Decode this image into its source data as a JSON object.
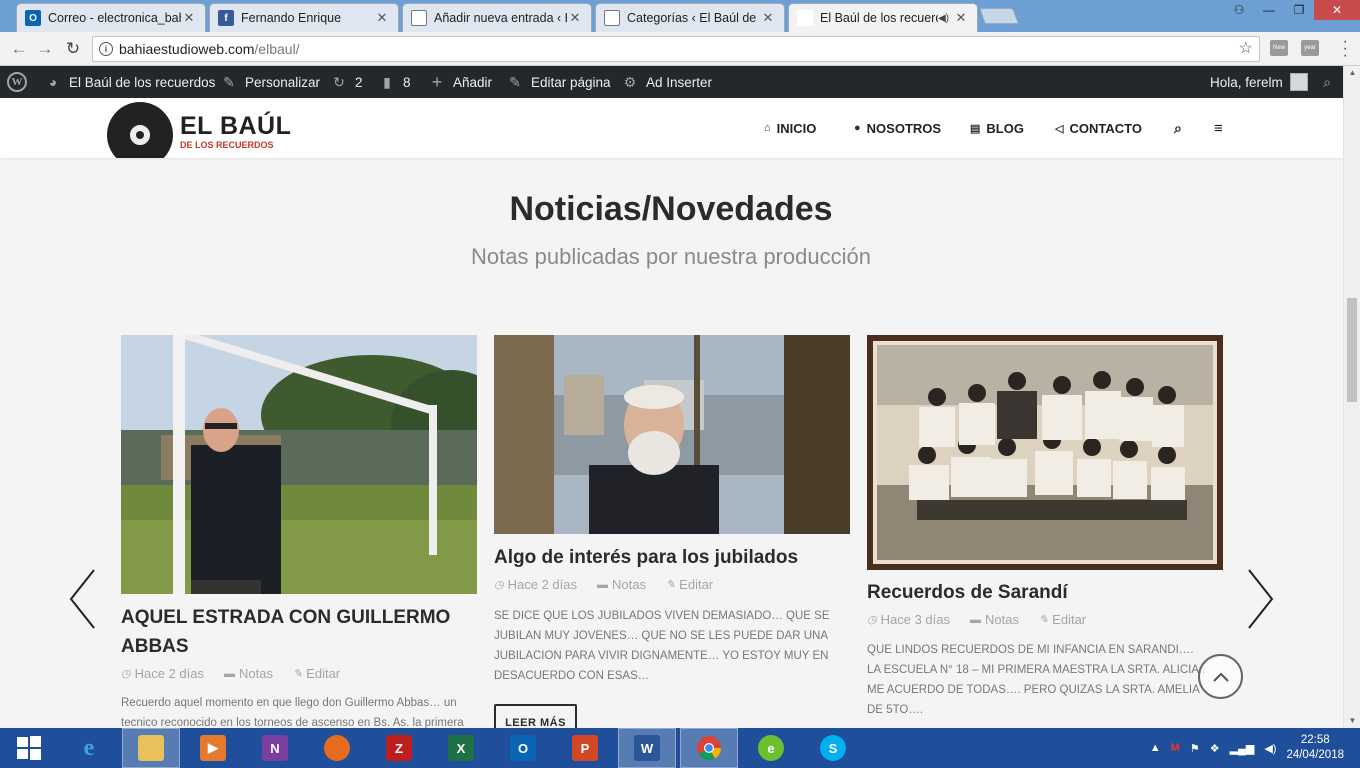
{
  "browser": {
    "tabs": [
      {
        "title": "Correo - electronica_bahi",
        "favicon": "outlook-icon",
        "active": false
      },
      {
        "title": "Fernando Enrique",
        "favicon": "facebook-icon",
        "active": false
      },
      {
        "title": "Añadir nueva entrada ‹ El",
        "favicon": "page-icon",
        "active": false
      },
      {
        "title": "Categorías ‹ El Baúl de lo",
        "favicon": "page-icon",
        "active": false
      },
      {
        "title": "El Baúl de los recuerdo",
        "favicon": "blank-page-icon",
        "active": true
      }
    ],
    "url_host": "bahiaestudioweb.com",
    "url_path": "/elbaul/",
    "extensions": [
      "New",
      "year"
    ]
  },
  "wp_admin_bar": {
    "site_name": "El Baúl de los recuerdos",
    "customize": "Personalizar",
    "updates": "2",
    "comments": "8",
    "add_new": "Añadir",
    "edit_page": "Editar página",
    "ad_inserter": "Ad Inserter",
    "greeting": "Hola, ferelm"
  },
  "site": {
    "logo_title": "EL BAÚL",
    "logo_subtitle": "DE LOS RECUERDOS",
    "nav": [
      "INICIO",
      "NOSOTROS",
      "BLOG",
      "CONTACTO"
    ],
    "accent_color": "#c0392b"
  },
  "section": {
    "title": "Noticias/Novedades",
    "subtitle": "Notas publicadas por nuestra producción"
  },
  "posts": [
    {
      "title": "AQUEL ESTRADA CON GUILLERMO ABBAS",
      "date": "Hace 2 días",
      "category": "Notas",
      "edit": "Editar",
      "excerpt": "Recuerdo aquel momento en que llego don Guillermo Abbas… un tecnico reconocido en los torneos de ascenso en Bs. As. la primera"
    },
    {
      "title": "Algo de interés para los jubilados",
      "date": "Hace 2 días",
      "category": "Notas",
      "edit": "Editar",
      "excerpt": "SE DICE QUE LOS JUBILADOS VIVEN DEMASIADO… QUE SE JUBILAN MUY JOVENES… QUE NO SE LES PUEDE DAR UNA JUBILACION PARA VIVIR DIGNAMENTE… YO ESTOY MUY EN DESACUERDO CON ESAS…",
      "read_more": "LEER MÁS"
    },
    {
      "title": "Recuerdos de Sarandí",
      "date": "Hace 3 días",
      "category": "Notas",
      "edit": "Editar",
      "excerpt": "QUE LINDOS RECUERDOS DE MI INFANCIA EN SARANDI…. LA ESCUELA N° 18 – MI PRIMERA MAESTRA LA SRTA. ALICIA.. ME ACUERDO DE TODAS…. PERO QUIZAS LA SRTA. AMELIA DE 5TO…."
    }
  ],
  "taskbar": {
    "apps": [
      "internet-explorer",
      "file-explorer",
      "media-player",
      "onenote",
      "firefox",
      "filezilla",
      "excel",
      "outlook",
      "powerpoint",
      "word",
      "chrome",
      "dreamweaver",
      "skype"
    ],
    "time": "22:58",
    "date": "24/04/2018"
  }
}
